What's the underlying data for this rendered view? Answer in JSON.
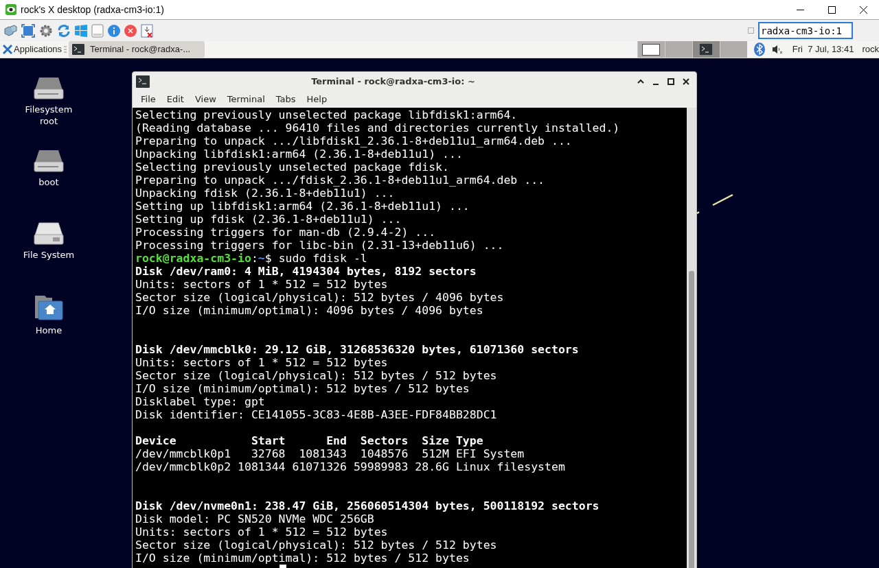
{
  "window": {
    "title": "rock's X desktop (radxa-cm3-io:1)"
  },
  "viewer_toolbar": {
    "checkbox": {
      "checked": false
    },
    "host_field": {
      "value": "radxa-cm3-io:1"
    }
  },
  "panel": {
    "applications": "Applications",
    "tasks": [
      {
        "label": "Terminal - rock@radxa-...",
        "selected": true
      }
    ],
    "workspaces": [
      {
        "selected": false
      },
      {
        "selected": false
      },
      {
        "selected": true
      },
      {
        "selected": false
      }
    ],
    "clock": "Fri  7 Jul, 13:41",
    "user": "rock"
  },
  "desktop_icons": [
    {
      "label": "Filesystem root",
      "kind": "drive"
    },
    {
      "label": "boot",
      "kind": "drive"
    },
    {
      "label": "File System",
      "kind": "disk"
    },
    {
      "label": "Home",
      "kind": "home"
    }
  ],
  "terminal": {
    "title": "Terminal - rock@radxa-cm3-io: ~",
    "menu": [
      "File",
      "Edit",
      "View",
      "Terminal",
      "Tabs",
      "Help"
    ],
    "lines": [
      {
        "kind": "plain",
        "text": "Selecting previously unselected package libfdisk1:arm64."
      },
      {
        "kind": "plain",
        "text": "(Reading database ... 96410 files and directories currently installed.)"
      },
      {
        "kind": "plain",
        "text": "Preparing to unpack .../libfdisk1_2.36.1-8+deb11u1_arm64.deb ..."
      },
      {
        "kind": "plain",
        "text": "Unpacking libfdisk1:arm64 (2.36.1-8+deb11u1) ..."
      },
      {
        "kind": "plain",
        "text": "Selecting previously unselected package fdisk."
      },
      {
        "kind": "plain",
        "text": "Preparing to unpack .../fdisk_2.36.1-8+deb11u1_arm64.deb ..."
      },
      {
        "kind": "plain",
        "text": "Unpacking fdisk (2.36.1-8+deb11u1) ..."
      },
      {
        "kind": "plain",
        "text": "Setting up libfdisk1:arm64 (2.36.1-8+deb11u1) ..."
      },
      {
        "kind": "plain",
        "text": "Setting up fdisk (2.36.1-8+deb11u1) ..."
      },
      {
        "kind": "plain",
        "text": "Processing triggers for man-db (2.9.4-2) ..."
      },
      {
        "kind": "plain",
        "text": "Processing triggers for libc-bin (2.31-13+deb11u6) ..."
      },
      {
        "kind": "prompt",
        "user": "rock@radxa-cm3-io",
        "sep": ":",
        "path": "~",
        "command": "$ sudo fdisk -l"
      },
      {
        "kind": "bold",
        "text": "Disk /dev/ram0: 4 MiB, 4194304 bytes, 8192 sectors"
      },
      {
        "kind": "plain",
        "text": "Units: sectors of 1 * 512 = 512 bytes"
      },
      {
        "kind": "plain",
        "text": "Sector size (logical/physical): 512 bytes / 4096 bytes"
      },
      {
        "kind": "plain",
        "text": "I/O size (minimum/optimal): 4096 bytes / 4096 bytes"
      },
      {
        "kind": "blank"
      },
      {
        "kind": "blank"
      },
      {
        "kind": "bold",
        "text": "Disk /dev/mmcblk0: 29.12 GiB, 31268536320 bytes, 61071360 sectors"
      },
      {
        "kind": "plain",
        "text": "Units: sectors of 1 * 512 = 512 bytes"
      },
      {
        "kind": "plain",
        "text": "Sector size (logical/physical): 512 bytes / 512 bytes"
      },
      {
        "kind": "plain",
        "text": "I/O size (minimum/optimal): 512 bytes / 512 bytes"
      },
      {
        "kind": "plain",
        "text": "Disklabel type: gpt"
      },
      {
        "kind": "plain",
        "text": "Disk identifier: CE141055-3C83-4E8B-A3EE-FDF84BB28DC1"
      },
      {
        "kind": "blank"
      },
      {
        "kind": "bold",
        "text": "Device           Start      End  Sectors  Size Type"
      },
      {
        "kind": "plain",
        "text": "/dev/mmcblk0p1   32768  1081343  1048576  512M EFI System"
      },
      {
        "kind": "plain",
        "text": "/dev/mmcblk0p2 1081344 61071326 59989983 28.6G Linux filesystem"
      },
      {
        "kind": "blank"
      },
      {
        "kind": "blank"
      },
      {
        "kind": "bold",
        "text": "Disk /dev/nvme0n1: 238.47 GiB, 256060514304 bytes, 500118192 sectors"
      },
      {
        "kind": "plain",
        "text": "Disk model: PC SN520 NVMe WDC 256GB"
      },
      {
        "kind": "plain",
        "text": "Units: sectors of 1 * 512 = 512 bytes"
      },
      {
        "kind": "plain",
        "text": "Sector size (logical/physical): 512 bytes / 512 bytes"
      },
      {
        "kind": "plain",
        "text": "I/O size (minimum/optimal): 512 bytes / 512 bytes"
      },
      {
        "kind": "cursor"
      }
    ]
  }
}
